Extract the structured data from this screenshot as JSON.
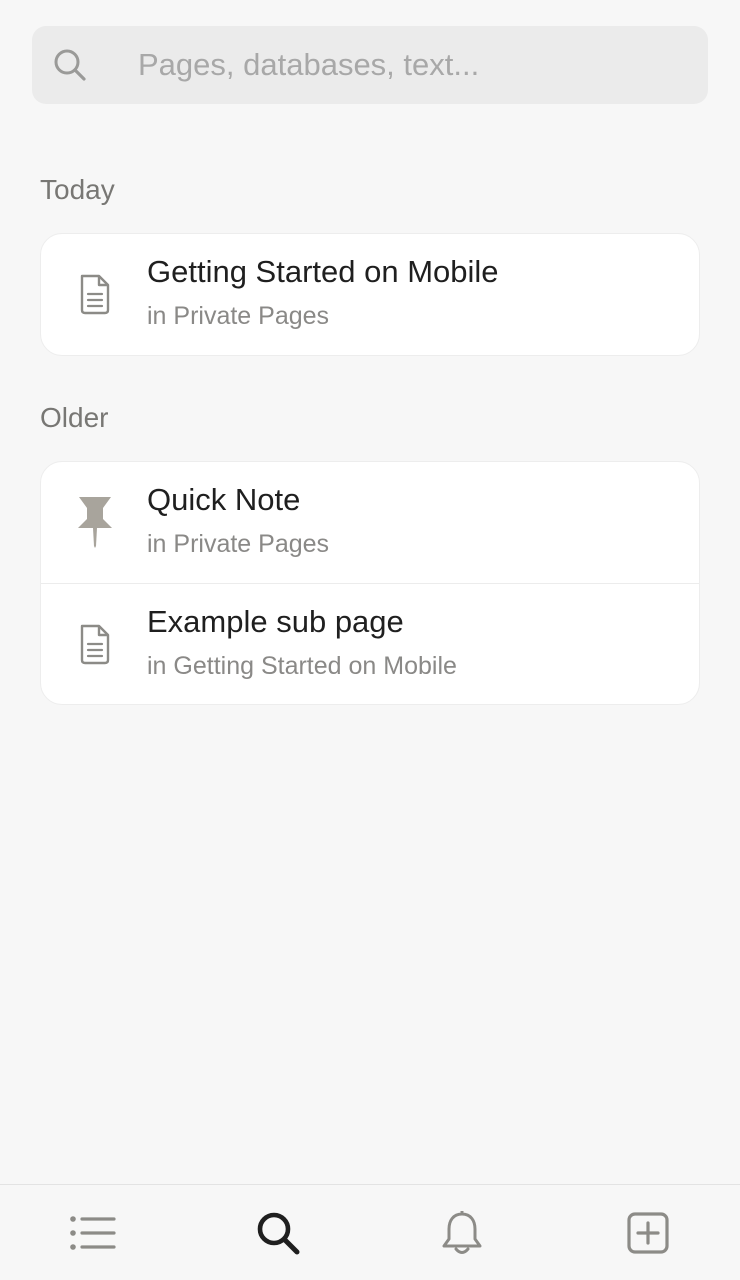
{
  "search": {
    "placeholder": "Pages, databases, text...",
    "icon": "search-icon"
  },
  "sections": [
    {
      "label": "Today",
      "items": [
        {
          "title": "Getting Started on Mobile",
          "subtitle": "in Private Pages",
          "icon": "page-icon"
        }
      ]
    },
    {
      "label": "Older",
      "items": [
        {
          "title": "Quick Note",
          "subtitle": "in Private Pages",
          "icon": "pin-icon"
        },
        {
          "title": "Example sub page",
          "subtitle": "in Getting Started on Mobile",
          "icon": "page-icon"
        }
      ]
    }
  ],
  "tab_bar": {
    "tabs": [
      {
        "icon": "list-icon",
        "active": false
      },
      {
        "icon": "search-icon",
        "active": true
      },
      {
        "icon": "bell-icon",
        "active": false
      },
      {
        "icon": "new-page-icon",
        "active": false
      }
    ]
  },
  "colors": {
    "background": "#f7f7f7",
    "search_bar": "#ebebeb",
    "card": "#ffffff",
    "text_primary": "#1f1f1f",
    "text_secondary": "#8a8987",
    "icon_gray": "#8c8b87"
  }
}
